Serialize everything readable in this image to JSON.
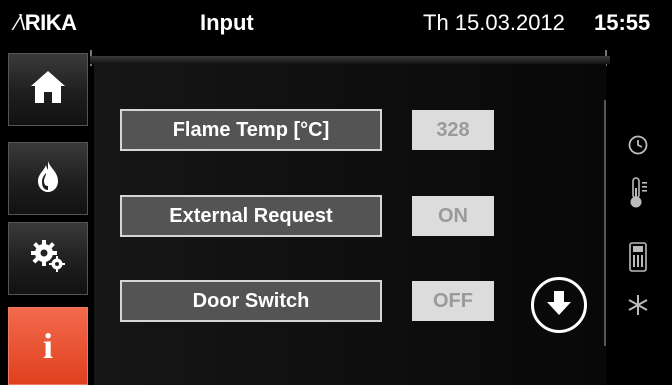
{
  "header": {
    "logo_mark": "⁄\\",
    "logo_text": "RIKA",
    "title": "Input",
    "date": "Th 15.03.2012",
    "time": "15:55"
  },
  "sidebar": {
    "items": [
      {
        "name": "home",
        "icon": "house-icon",
        "active": false
      },
      {
        "name": "flame",
        "icon": "flame-icon",
        "active": false
      },
      {
        "name": "settings",
        "icon": "gears-icon",
        "active": false
      },
      {
        "name": "info",
        "icon": "info-icon",
        "active": true,
        "glyph": "i"
      }
    ]
  },
  "rows": [
    {
      "label": "Flame Temp [°C]",
      "value": "328"
    },
    {
      "label": "External Request",
      "value": "ON"
    },
    {
      "label": "Door Switch",
      "value": "OFF"
    }
  ],
  "status_icons": [
    "clock-icon",
    "thermometer-icon",
    "room-control-icon",
    "snowflake-icon"
  ],
  "colors": {
    "accent": "#e8472a",
    "panel": "#545454",
    "value_bg": "#dcdcdc"
  }
}
